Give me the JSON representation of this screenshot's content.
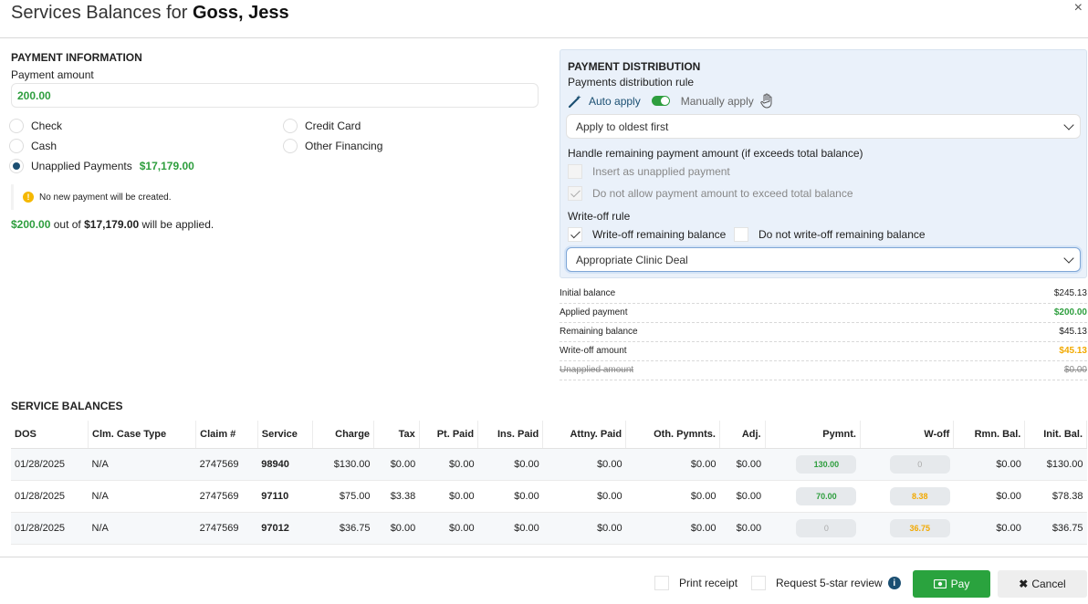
{
  "header": {
    "title_prefix": "Services Balances for",
    "patient": "Goss, Jess",
    "close": "×"
  },
  "payment_info": {
    "section_title": "PAYMENT INFORMATION",
    "amount_label": "Payment amount",
    "amount_value": "200.00",
    "methods": {
      "check": "Check",
      "credit_card": "Credit Card",
      "cash": "Cash",
      "other_financing": "Other Financing",
      "unapplied": "Unapplied Payments",
      "unapplied_amount": "$17,179.00"
    },
    "notice": "No new payment will be created.",
    "applied_amount": "$200.00",
    "applied_mid": "out of",
    "applied_total": "$17,179.00",
    "applied_suffix": "will be applied."
  },
  "distribution": {
    "section_title": "PAYMENT DISTRIBUTION",
    "rule_label": "Payments distribution rule",
    "auto_apply": "Auto apply",
    "manual_apply": "Manually apply",
    "rule_select": "Apply to oldest first",
    "remaining_label": "Handle remaining payment amount (if exceeds total balance)",
    "opt_insert_unapplied": "Insert as unapplied payment",
    "opt_not_exceed": "Do not allow payment amount to exceed total balance",
    "writeoff_label": "Write-off rule",
    "opt_writeoff": "Write-off remaining balance",
    "opt_no_writeoff": "Do not write-off remaining balance",
    "writeoff_select": "Appropriate Clinic Deal"
  },
  "summary": [
    {
      "label": "Initial balance",
      "value": "$245.13",
      "color": "#222222"
    },
    {
      "label": "Applied payment",
      "value": "$200.00",
      "color": "#2e9e3e"
    },
    {
      "label": "Remaining balance",
      "value": "$45.13",
      "color": "#222222"
    },
    {
      "label": "Write-off amount",
      "value": "$45.13",
      "color": "#f2a900"
    },
    {
      "label": "Unapplied amount",
      "value": "$0.00",
      "color": "#888888"
    }
  ],
  "service_balances": {
    "section_title": "SERVICE BALANCES",
    "columns": [
      "DOS",
      "Clm. Case Type",
      "Claim #",
      "Service",
      "Charge",
      "Tax",
      "Pt. Paid",
      "Ins. Paid",
      "Attny. Paid",
      "Oth. Pymnts.",
      "Adj.",
      "Pymnt.",
      "W-off",
      "Rmn. Bal.",
      "Init. Bal."
    ],
    "rows": [
      {
        "dos": "01/28/2025",
        "case_type": "N/A",
        "claim": "2747569",
        "service": "98940",
        "charge": "$130.00",
        "tax": "$0.00",
        "pt_paid": "$0.00",
        "ins_paid": "$0.00",
        "attny_paid": "$0.00",
        "oth": "$0.00",
        "adj": "$0.00",
        "pymnt": "130.00",
        "woff": "0",
        "rmn": "$0.00",
        "init": "$130.00"
      },
      {
        "dos": "01/28/2025",
        "case_type": "N/A",
        "claim": "2747569",
        "service": "97110",
        "charge": "$75.00",
        "tax": "$3.38",
        "pt_paid": "$0.00",
        "ins_paid": "$0.00",
        "attny_paid": "$0.00",
        "oth": "$0.00",
        "adj": "$0.00",
        "pymnt": "70.00",
        "woff": "8.38",
        "rmn": "$0.00",
        "init": "$78.38"
      },
      {
        "dos": "01/28/2025",
        "case_type": "N/A",
        "claim": "2747569",
        "service": "97012",
        "charge": "$36.75",
        "tax": "$0.00",
        "pt_paid": "$0.00",
        "ins_paid": "$0.00",
        "attny_paid": "$0.00",
        "oth": "$0.00",
        "adj": "$0.00",
        "pymnt": "0",
        "woff": "36.75",
        "rmn": "$0.00",
        "init": "$36.75"
      }
    ]
  },
  "footer": {
    "print_receipt": "Print receipt",
    "request_review": "Request 5-star review",
    "pay": "Pay",
    "cancel": "Cancel"
  },
  "icons": [
    "magic-wand-icon",
    "hand-icon",
    "info-icon",
    "cash-icon",
    "close-icon"
  ]
}
